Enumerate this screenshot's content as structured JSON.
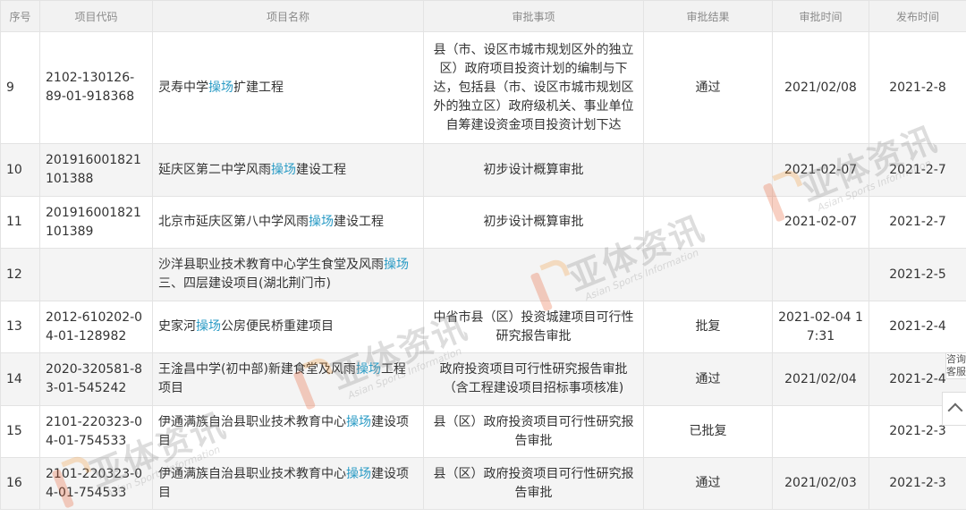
{
  "columns": [
    "序号",
    "项目代码",
    "项目名称",
    "审批事项",
    "审批结果",
    "审批时间",
    "发布时间"
  ],
  "rows": [
    {
      "no": "9",
      "code": "2102-130126-89-01-918368",
      "name_pre": "灵寿中学",
      "name_hl": "操场",
      "name_post": "扩建工程",
      "item": "县（市、设区市城市规划区外的独立区）政府项目投资计划的编制与下达，包括县（市、设区市城市规划区外的独立区）政府级机关、事业单位自筹建设资金项目投资计划下达",
      "result": "通过",
      "approve": "2021/02/08",
      "publish": "2021-2-8"
    },
    {
      "no": "10",
      "code": "201916001821101388",
      "name_pre": "延庆区第二中学风雨",
      "name_hl": "操场",
      "name_post": "建设工程",
      "item": "初步设计概算审批",
      "result": "",
      "approve": "2021-02-07",
      "publish": "2021-2-7"
    },
    {
      "no": "11",
      "code": "201916001821101389",
      "name_pre": "北京市延庆区第八中学风雨",
      "name_hl": "操场",
      "name_post": "建设工程",
      "item": "初步设计概算审批",
      "result": "",
      "approve": "2021-02-07",
      "publish": "2021-2-7"
    },
    {
      "no": "12",
      "code": "",
      "name_pre": "沙洋县职业技术教育中心学生食堂及风雨",
      "name_hl": "操场",
      "name_post": "三、四层建设项目(湖北荆门市)",
      "item": "",
      "result": "",
      "approve": "",
      "publish": "2021-2-5"
    },
    {
      "no": "13",
      "code": "2012-610202-04-01-128982",
      "name_pre": "史家河",
      "name_hl": "操场",
      "name_post": "公房便民桥重建项目",
      "item": "中省市县（区）投资城建项目可行性研究报告审批",
      "result": "批复",
      "approve": "2021-02-04 17:31",
      "publish": "2021-2-4"
    },
    {
      "no": "14",
      "code": "2020-320581-83-01-545242",
      "name_pre": "王淦昌中学(初中部)新建食堂及风雨",
      "name_hl": "操场",
      "name_post": "工程项目",
      "item": "政府投资项目可行性研究报告审批（含工程建设项目招标事项核准)",
      "result": "通过",
      "approve": "2021/02/04",
      "publish": "2021-2-4"
    },
    {
      "no": "15",
      "code": "2101-220323-04-01-754533",
      "name_pre": "伊通满族自治县职业技术教育中心",
      "name_hl": "操场",
      "name_post": "建设项目",
      "item": "县（区）政府投资项目可行性研究报告审批",
      "result": "已批复",
      "approve": "",
      "publish": "2021-2-3"
    },
    {
      "no": "16",
      "code": "2101-220323-04-01-754533",
      "name_pre": "伊通满族自治县职业技术教育中心",
      "name_hl": "操场",
      "name_post": "建设项目",
      "item": "县（区）政府投资项目可行性研究报告审批",
      "result": "通过",
      "approve": "2021/02/03",
      "publish": "2021-2-3"
    }
  ],
  "watermark": {
    "cn": "亚体资讯",
    "en": "Asian Sports Information"
  },
  "side": {
    "consult_label": "咨询客服"
  },
  "colors": {
    "highlight": "#2a9bc5",
    "header_bg": "#f2f2f2",
    "alt_row_bg": "#f4f4f4",
    "border": "#e3e3e3"
  }
}
